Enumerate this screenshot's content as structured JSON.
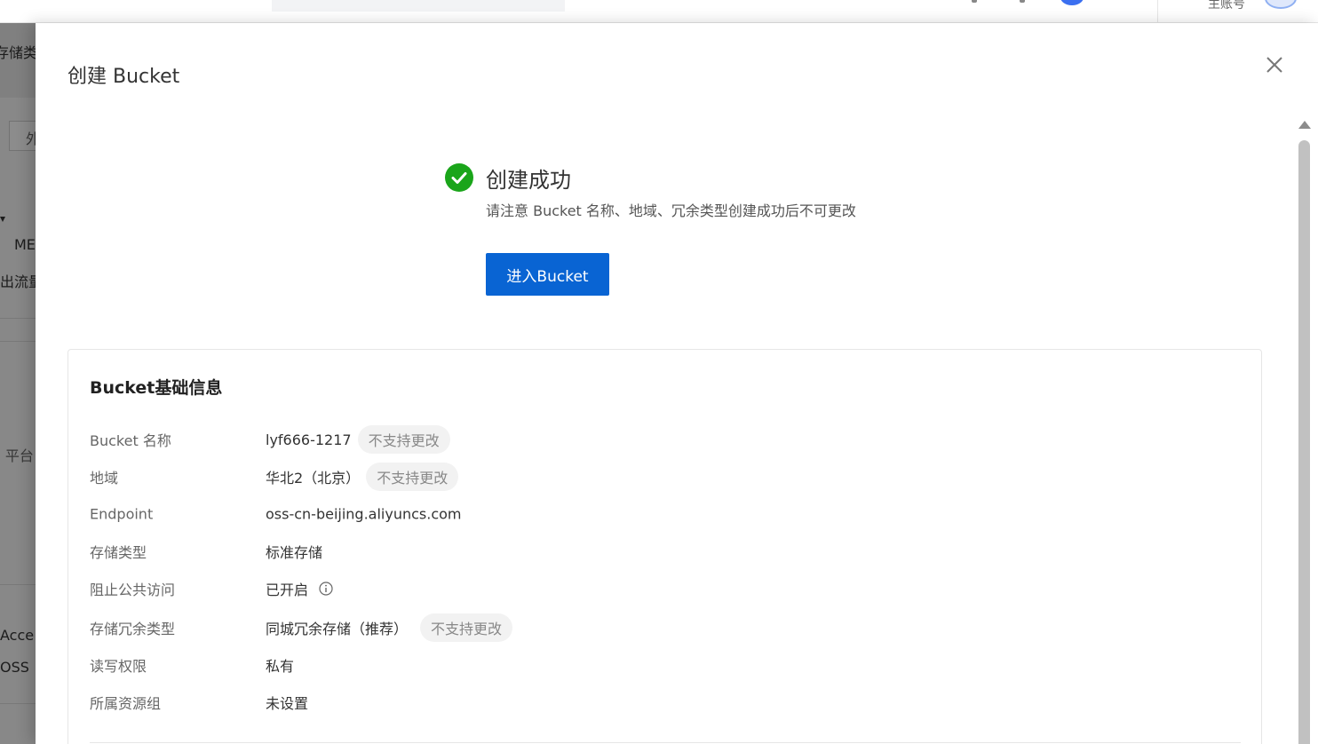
{
  "topbar": {
    "account_label": "主账号"
  },
  "background": {
    "fragments": [
      "存储类",
      "外",
      "ME",
      "出流量",
      "c 平台",
      "Acce",
      "OSS"
    ]
  },
  "drawer": {
    "title": "创建 Bucket",
    "success": {
      "title": "创建成功",
      "description": "请注意 Bucket 名称、地域、冗余类型创建成功后不可更改",
      "button_label": "进入Bucket"
    },
    "info_card": {
      "title": "Bucket基础信息",
      "rows": [
        {
          "label": "Bucket 名称",
          "value": "lyf666-1217",
          "tag": "不支持更改"
        },
        {
          "label": "地域",
          "value": "华北2（北京）",
          "tag": "不支持更改"
        },
        {
          "label": "Endpoint",
          "value": "oss-cn-beijing.aliyuncs.com"
        },
        {
          "label": "存储类型",
          "value": "标准存储"
        },
        {
          "label": "阻止公共访问",
          "value": "已开启"
        },
        {
          "label": "存储冗余类型",
          "value": "同城冗余存储（推荐）",
          "tag": "不支持更改"
        },
        {
          "label": "读写权限",
          "value": "私有"
        },
        {
          "label": "所属资源组",
          "value": "未设置"
        }
      ]
    }
  },
  "colors": {
    "primary": "#0964d3",
    "success": "#1aa51a",
    "tag_bg": "#f2f2f2"
  }
}
